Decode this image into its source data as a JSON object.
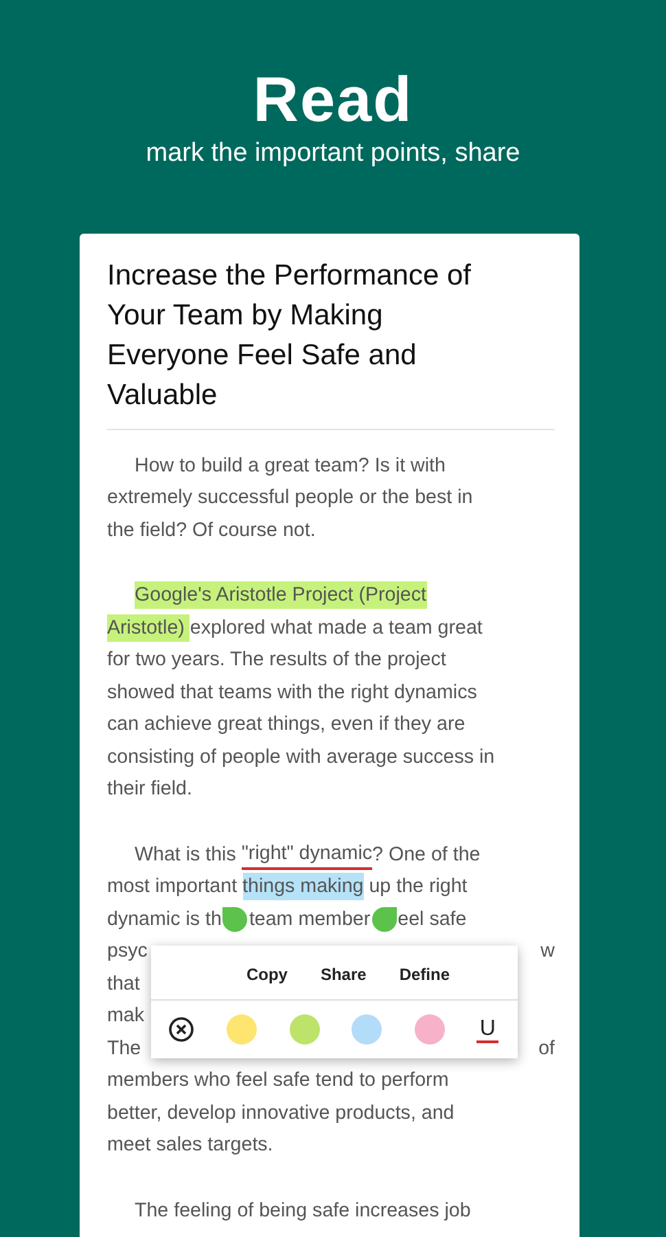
{
  "header": {
    "title": "Read",
    "subtitle": "mark the important points, share"
  },
  "article": {
    "title": "Increase the Performance of Your Team by Making Everyone Feel Safe and Valuable",
    "paragraphs": [
      {
        "lines": [
          [
            {
              "kind": "text",
              "text": "How to build a great team? Is it with"
            }
          ],
          [
            {
              "kind": "text",
              "text": "extremely successful people or the best in"
            }
          ],
          [
            {
              "kind": "text",
              "text": "the field? Of course not."
            }
          ]
        ]
      },
      {
        "lines": [
          [
            {
              "kind": "text",
              "text": "Google's Aristotle Project (Project",
              "color": "#c6f27c"
            }
          ],
          [
            {
              "kind": "text",
              "text": "Aristotle) ",
              "color": "#c6f27c"
            },
            {
              "kind": "text",
              "text": "explored what made a team great"
            }
          ],
          [
            {
              "kind": "text",
              "text": "for two years. The results of the project"
            }
          ],
          [
            {
              "kind": "text",
              "text": "showed that teams with the right dynamics"
            }
          ],
          [
            {
              "kind": "text",
              "text": "can achieve great things, even if they are"
            }
          ],
          [
            {
              "kind": "text",
              "text": "consisting of people with average success in"
            }
          ],
          [
            {
              "kind": "text",
              "text": "their field."
            }
          ]
        ]
      },
      {
        "lines": [
          [
            {
              "kind": "text",
              "text": "What is this "
            },
            {
              "kind": "text",
              "text": "\"right\" dynamic",
              "underline": true
            },
            {
              "kind": "text",
              "text": "? One of the"
            }
          ],
          [
            {
              "kind": "text",
              "text": "most important "
            },
            {
              "kind": "text",
              "text": "things making",
              "color": "#b5e2f7"
            },
            {
              "kind": "text",
              "text": " up the right"
            }
          ],
          [
            {
              "kind": "text",
              "text": "dynamic is th"
            },
            {
              "kind": "handle"
            },
            {
              "kind": "text",
              "text": "team member"
            },
            {
              "kind": "handle"
            },
            {
              "kind": "text",
              "text": "eel safe"
            }
          ],
          [
            {
              "kind": "text",
              "text": "psyc"
            },
            {
              "kind": "gap"
            },
            {
              "kind": "text",
              "text": "w"
            }
          ],
          [
            {
              "kind": "text",
              "text": "that"
            }
          ],
          [
            {
              "kind": "text",
              "text": "mak"
            }
          ],
          [
            {
              "kind": "text",
              "text": "The"
            },
            {
              "kind": "gap"
            },
            {
              "kind": "text",
              "text": "of"
            }
          ],
          [
            {
              "kind": "text",
              "text": "members who feel safe tend to perform"
            }
          ],
          [
            {
              "kind": "text",
              "text": "better, develop innovative products, and"
            }
          ],
          [
            {
              "kind": "text",
              "text": "meet sales targets."
            }
          ]
        ]
      },
      {
        "lines": [
          [
            {
              "kind": "text",
              "text": "The feeling of being safe increases job"
            }
          ]
        ]
      }
    ]
  },
  "popup": {
    "actions": [
      "Copy",
      "Share",
      "Define"
    ],
    "tools": [
      {
        "kind": "clear"
      },
      {
        "kind": "swatch",
        "color": "#fde56f"
      },
      {
        "kind": "swatch",
        "color": "#bde36b"
      },
      {
        "kind": "swatch",
        "color": "#b3dcf8"
      },
      {
        "kind": "swatch",
        "color": "#f7b1c9"
      },
      {
        "kind": "underline",
        "label": "U"
      }
    ]
  }
}
